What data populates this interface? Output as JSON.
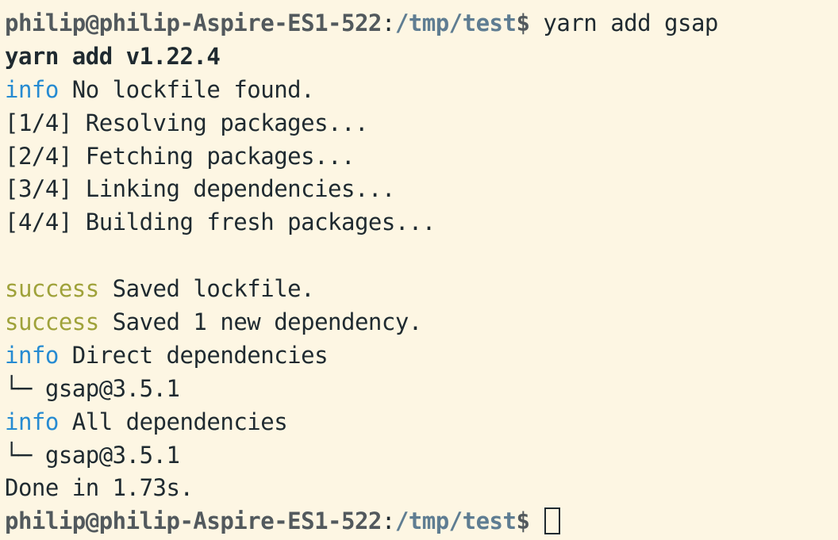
{
  "colors": {
    "background": "#fdf6e3",
    "text": "#1f2a30",
    "info": "#268bd2",
    "success": "#9fa23a",
    "prompt": "#52595d",
    "path": "#5f7d92"
  },
  "prompt": {
    "user_host": "philip@philip-Aspire-ES1-522",
    "separator": ":",
    "path": "/tmp/test",
    "dollar": "$"
  },
  "command": " yarn add gsap",
  "header": "yarn add v1.22.4",
  "keywords": {
    "info": "info",
    "success": "success"
  },
  "output": {
    "no_lockfile": " No lockfile found.",
    "steps": [
      "[1/4] Resolving packages...",
      "[2/4] Fetching packages...",
      "[3/4] Linking dependencies...",
      "[4/4] Building fresh packages..."
    ],
    "saved_lockfile": " Saved lockfile.",
    "saved_dependency": " Saved 1 new dependency.",
    "direct_dependencies": " Direct dependencies",
    "direct_tree": "└─ gsap@3.5.1",
    "all_dependencies": " All dependencies",
    "all_tree": "└─ gsap@3.5.1",
    "done": "Done in 1.73s."
  },
  "cursor_icon": "block-cursor-icon"
}
